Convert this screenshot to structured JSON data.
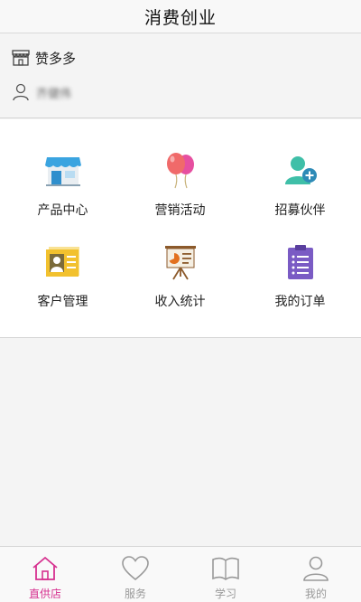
{
  "header": {
    "title": "消费创业"
  },
  "store": {
    "name": "赞多多",
    "owner": "齐健伟",
    "store_icon": "storefront-icon",
    "person_icon": "person-icon"
  },
  "menu": {
    "items": [
      {
        "label": "产品中心",
        "icon": "store-icon"
      },
      {
        "label": "营销活动",
        "icon": "balloons-icon"
      },
      {
        "label": "招募伙伴",
        "icon": "add-partner-icon"
      },
      {
        "label": "客户管理",
        "icon": "id-card-icon"
      },
      {
        "label": "收入统计",
        "icon": "presentation-board-icon"
      },
      {
        "label": "我的订单",
        "icon": "clipboard-icon"
      }
    ]
  },
  "tabbar": {
    "active_color": "#d6308f",
    "inactive_color": "#999999",
    "tabs": [
      {
        "label": "直供店",
        "icon": "home-icon",
        "active": true
      },
      {
        "label": "服务",
        "icon": "heart-icon",
        "active": false
      },
      {
        "label": "学习",
        "icon": "book-icon",
        "active": false
      },
      {
        "label": "我的",
        "icon": "user-icon",
        "active": false
      }
    ]
  }
}
